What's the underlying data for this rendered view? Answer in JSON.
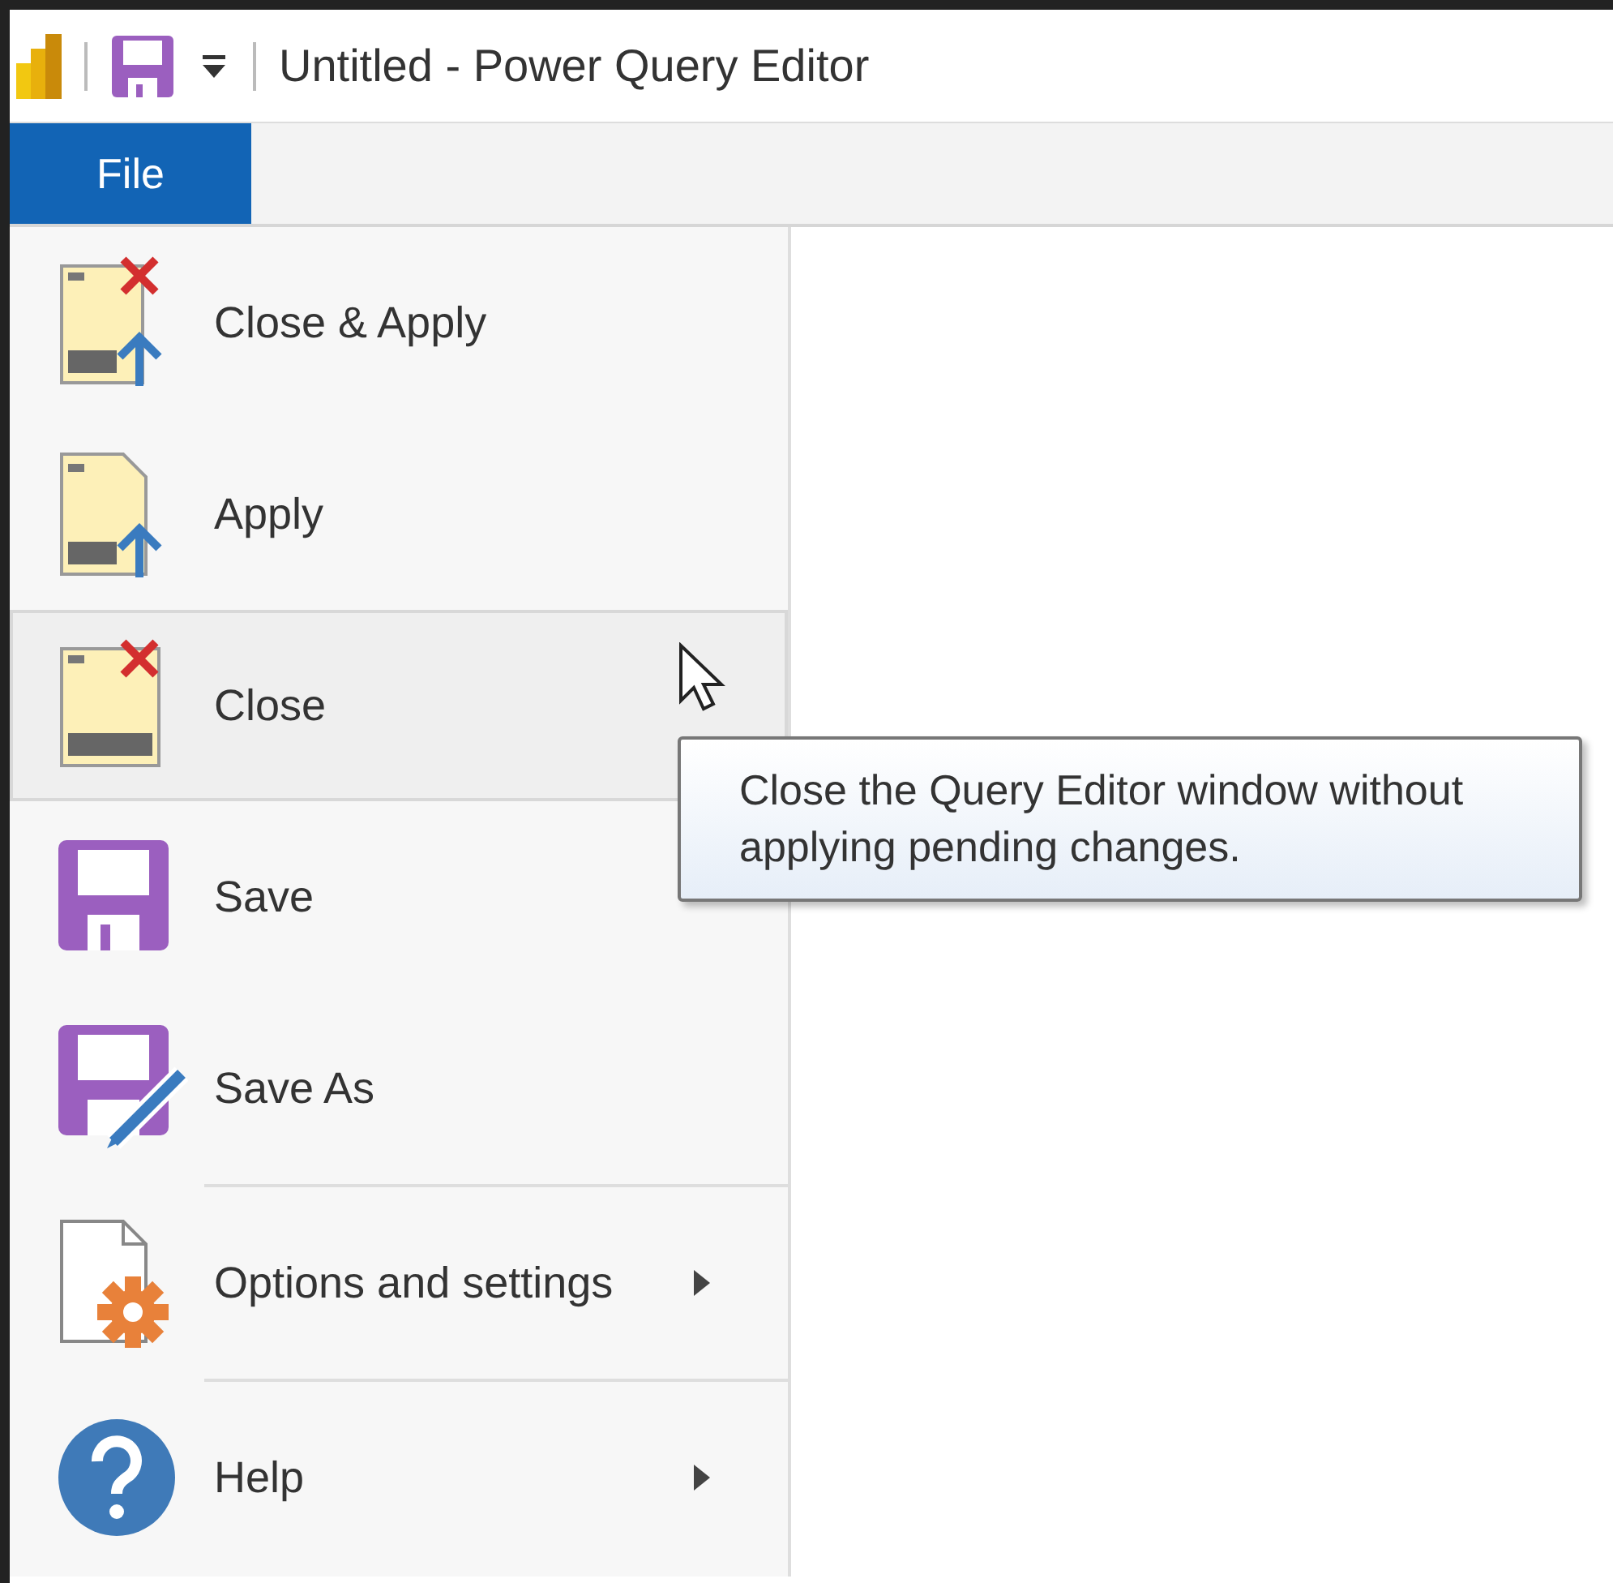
{
  "window": {
    "title": "Untitled - Power Query Editor"
  },
  "tabs": [
    {
      "label": "File",
      "selected": true
    }
  ],
  "menu": {
    "items": [
      {
        "kind": "closeapply",
        "label": "Close & Apply",
        "hovered": false,
        "submenu": false,
        "separator_before": false
      },
      {
        "kind": "apply",
        "label": "Apply",
        "hovered": false,
        "submenu": false,
        "separator_before": false
      },
      {
        "kind": "close",
        "label": "Close",
        "hovered": true,
        "submenu": false,
        "separator_before": false
      },
      {
        "kind": "save",
        "label": "Save",
        "hovered": false,
        "submenu": false,
        "separator_before": false
      },
      {
        "kind": "saveas",
        "label": "Save As",
        "hovered": false,
        "submenu": false,
        "separator_before": false
      },
      {
        "kind": "options",
        "label": "Options and settings",
        "hovered": false,
        "submenu": true,
        "separator_before": true
      },
      {
        "kind": "help",
        "label": "Help",
        "hovered": false,
        "submenu": true,
        "separator_before": true
      }
    ]
  },
  "tooltip": {
    "text": "Close the Query Editor window without applying pending changes."
  }
}
